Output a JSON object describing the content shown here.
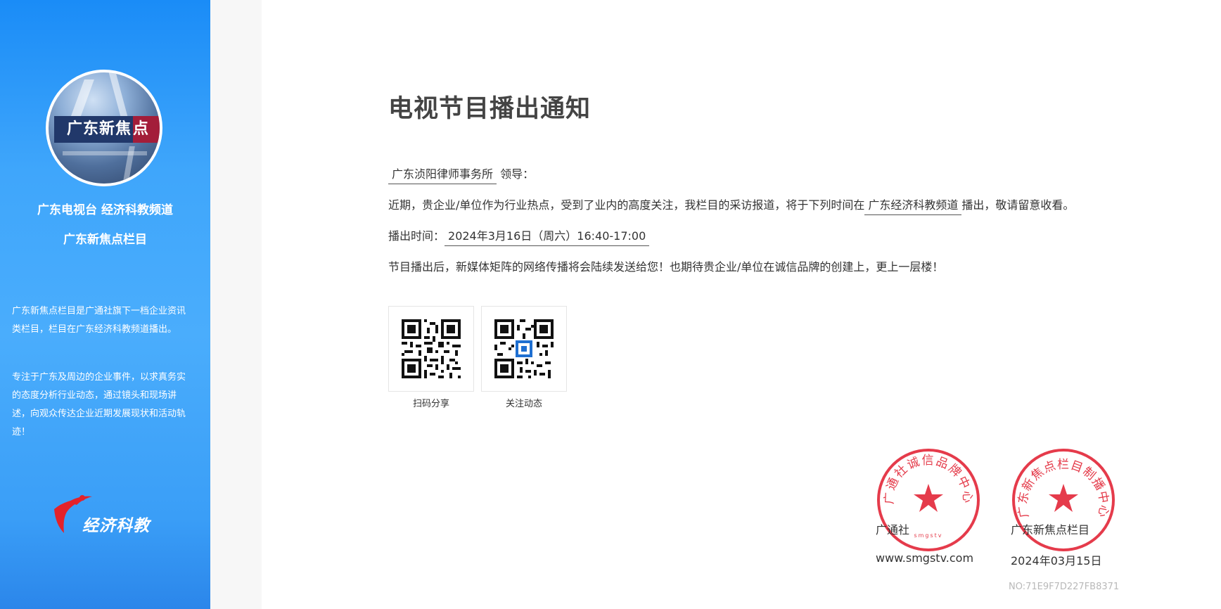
{
  "sidebar": {
    "logo_text_left": "广东新焦",
    "logo_text_right": "点",
    "channel_line1": "广东电视台 经济科教频道",
    "channel_line2": "广东新焦点栏目",
    "desc_para1": "广东新焦点栏目是广通社旗下一档企业资讯类栏目，栏目在广东经济科教频道播出。",
    "desc_para2": "专注于广东及周边的企业事件，以求真务实的态度分析行业动态，通过镜头和现场讲述，向观众传达企业近期发展现状和活动轨迹！",
    "brand_text": "经济科教"
  },
  "notice": {
    "title": "电视节目播出通知",
    "recipient": "广东浈阳律师事务所",
    "recipient_suffix": "领导：",
    "body_prefix": "近期，贵企业/单位作为行业热点，受到了业内的高度关注，我栏目的采访报道，将于下列时间在",
    "channel": "广东经济科教频道",
    "body_suffix": "播出，敬请留意收看。",
    "airtime_label": "播出时间：",
    "airtime_value": "2024年3月16日（周六）16:40-17:00",
    "closing": "节目播出后，新媒体矩阵的网络传播将会陆续发送给您！也期待贵企业/单位在诚信品牌的创建上，更上一层楼！"
  },
  "qr": {
    "share_label": "扫码分享",
    "follow_label": "关注动态"
  },
  "signatures": {
    "org1_name": "广通社",
    "org1_site": "www.smgstv.com",
    "org2_name": "广东新焦点栏目",
    "org2_date": "2024年03月15日",
    "seal1_text": "广通社诚信品牌中心",
    "seal1_small": "smgstv",
    "seal2_text": "广东新焦点栏目制播中心",
    "serial": "NO:71E9F7D227FB8371"
  },
  "colors": {
    "sidebar_top": "#1a8cf7",
    "sidebar_bottom": "#2b86ea",
    "seal_red": "#e0192b",
    "title_gray": "#444444"
  }
}
